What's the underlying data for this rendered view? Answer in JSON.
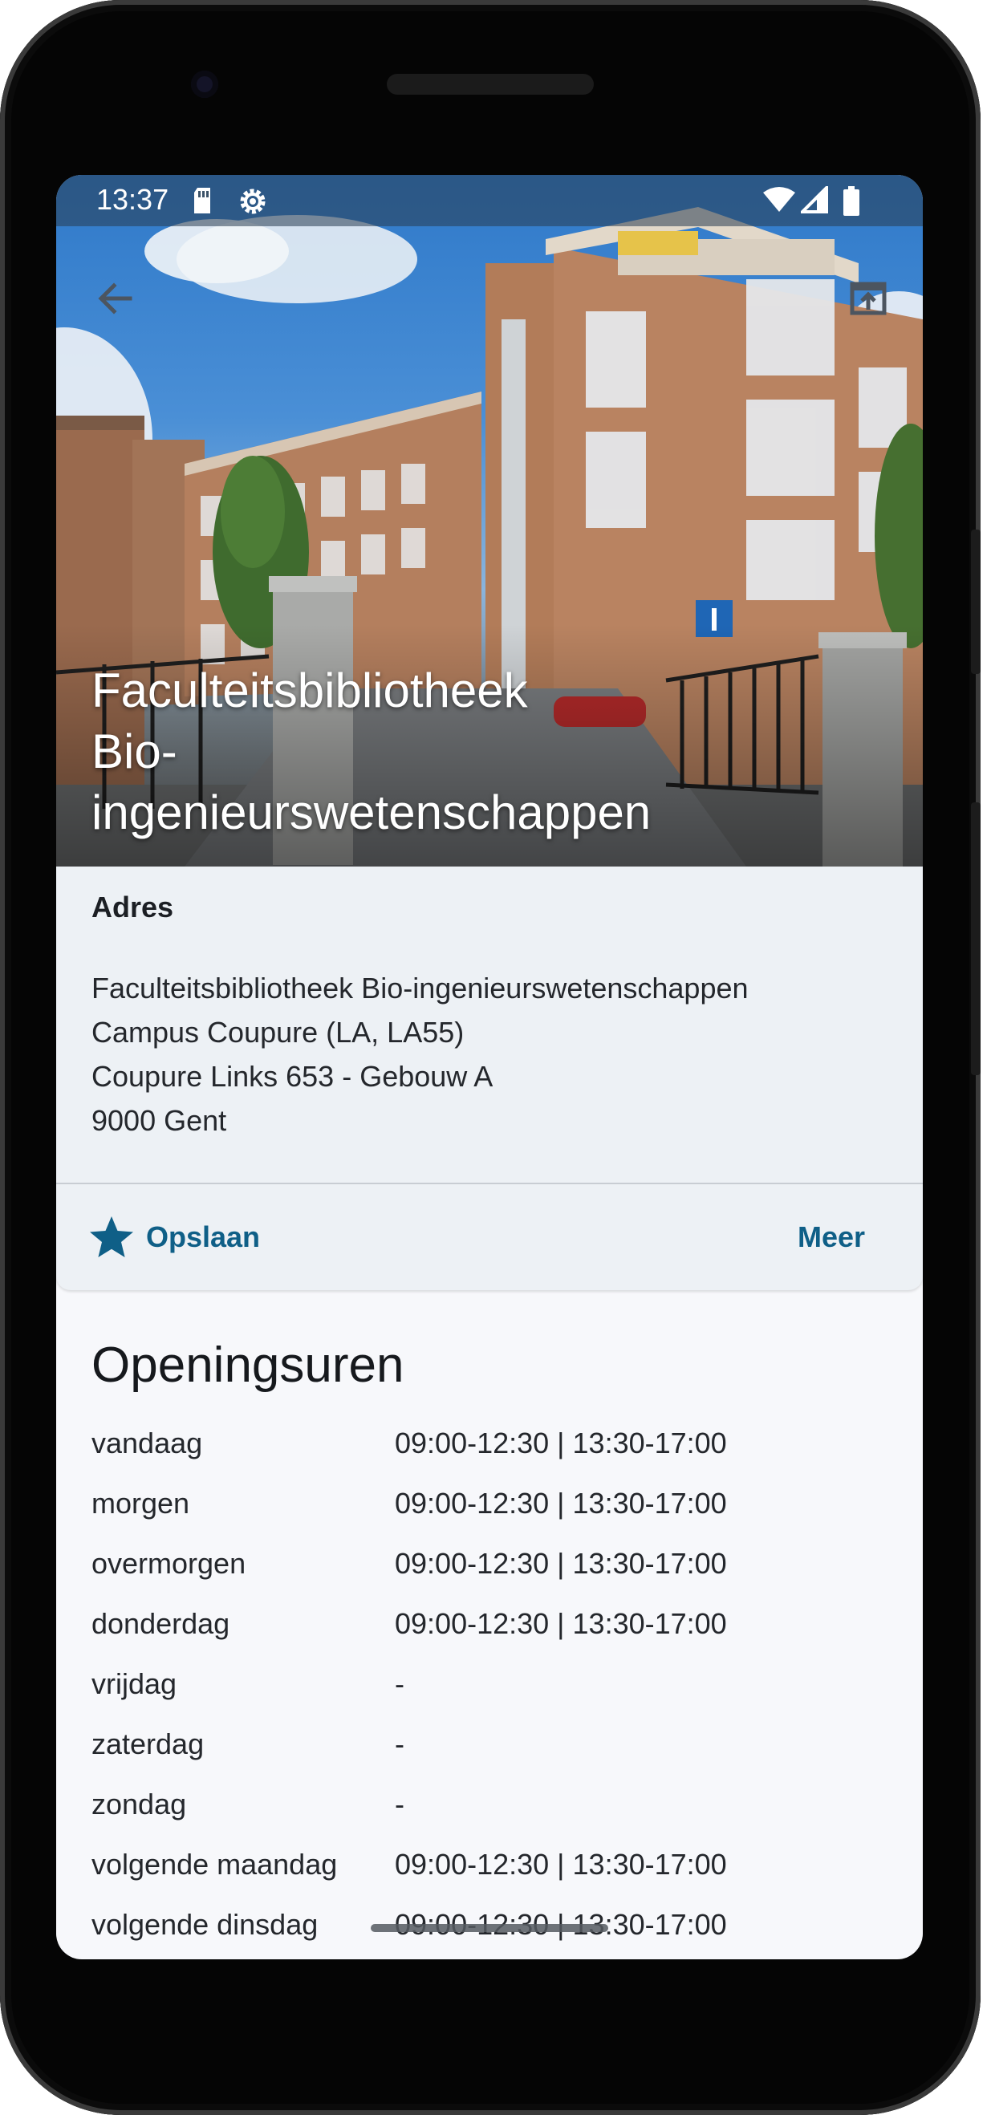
{
  "status_bar": {
    "time": "13:37",
    "icons": [
      "sd-card-icon",
      "settings-gear-icon",
      "wifi-icon",
      "cell-signal-icon",
      "battery-icon"
    ]
  },
  "header": {
    "title_lines": [
      "Faculteitsbibliotheek",
      "Bio-",
      "ingenieurswetenschappen"
    ],
    "back_icon": "arrow-left-icon",
    "open_icon": "open-in-new-icon"
  },
  "address": {
    "label": "Adres",
    "lines": [
      "Faculteitsbibliotheek Bio-ingenieurswetenschappen",
      "Campus Coupure (LA, LA55)",
      "Coupure Links 653 - Gebouw A",
      "9000 Gent"
    ]
  },
  "actions": {
    "save_label": "Opslaan",
    "save_icon": "star-icon",
    "more_label": "Meer"
  },
  "hours": {
    "title": "Openingsuren",
    "rows": [
      {
        "day": "vandaag",
        "time": "09:00-12:30 | 13:30-17:00"
      },
      {
        "day": "morgen",
        "time": "09:00-12:30 | 13:30-17:00"
      },
      {
        "day": "overmorgen",
        "time": "09:00-12:30 | 13:30-17:00"
      },
      {
        "day": "donderdag",
        "time": "09:00-12:30 | 13:30-17:00"
      },
      {
        "day": "vrijdag",
        "time": "-"
      },
      {
        "day": "zaterdag",
        "time": "-"
      },
      {
        "day": "zondag",
        "time": "-"
      },
      {
        "day": "volgende maandag",
        "time": "09:00-12:30 | 13:30-17:00"
      },
      {
        "day": "volgende dinsdag",
        "time": "09:00-12:30 | 13:30-17:00"
      }
    ]
  },
  "colors": {
    "accent": "#0f5f87",
    "card_background": "#edf1f5",
    "page_background": "#f7f8fb"
  }
}
